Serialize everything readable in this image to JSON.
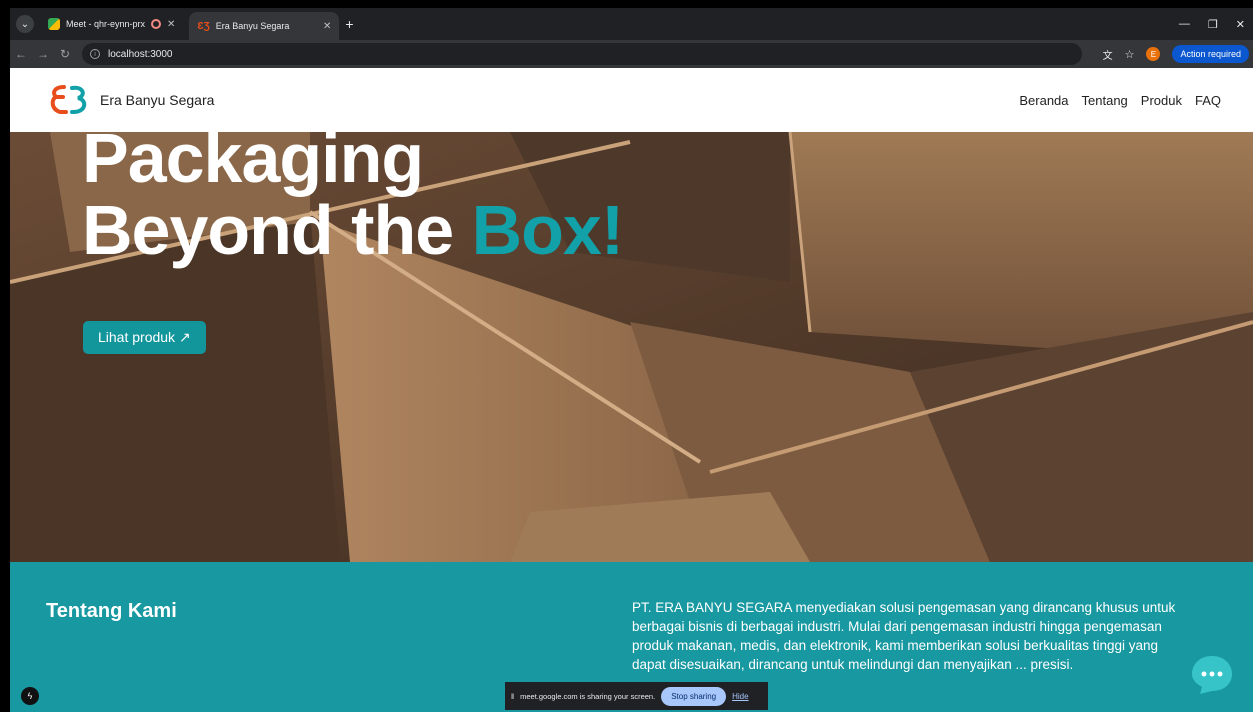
{
  "browser": {
    "tabs": [
      {
        "title": "Meet - qhr-eynn-prx"
      },
      {
        "title": "Era Banyu Segara"
      }
    ],
    "url": "localhost:3000",
    "action_required": "Action required",
    "profile_initial": "E"
  },
  "site": {
    "brand": "Era Banyu Segara",
    "nav": [
      "Beranda",
      "Tentang",
      "Produk",
      "FAQ"
    ]
  },
  "hero": {
    "line1": "Packaging",
    "line2_prefix": "Beyond the ",
    "line2_accent": "Box!",
    "cta": "Lihat produk ↗"
  },
  "about": {
    "title": "Tentang Kami",
    "text": "PT. ERA BANYU SEGARA menyediakan solusi pengemasan yang dirancang khusus untuk berbagai bisnis di berbagai industri. Mulai dari pengemasan industri hingga pengemasan produk makanan, medis, dan elektronik, kami memberikan solusi berkualitas tinggi yang dapat disesuaikan, dirancang untuk melindungi dan menyajikan ... presisi."
  },
  "share_bar": {
    "message": "meet.google.com is sharing your screen.",
    "stop": "Stop sharing",
    "hide": "Hide"
  },
  "colors": {
    "accent": "#12a1a8",
    "about_bg": "#1898a1",
    "logo_orange": "#e84e1b"
  }
}
